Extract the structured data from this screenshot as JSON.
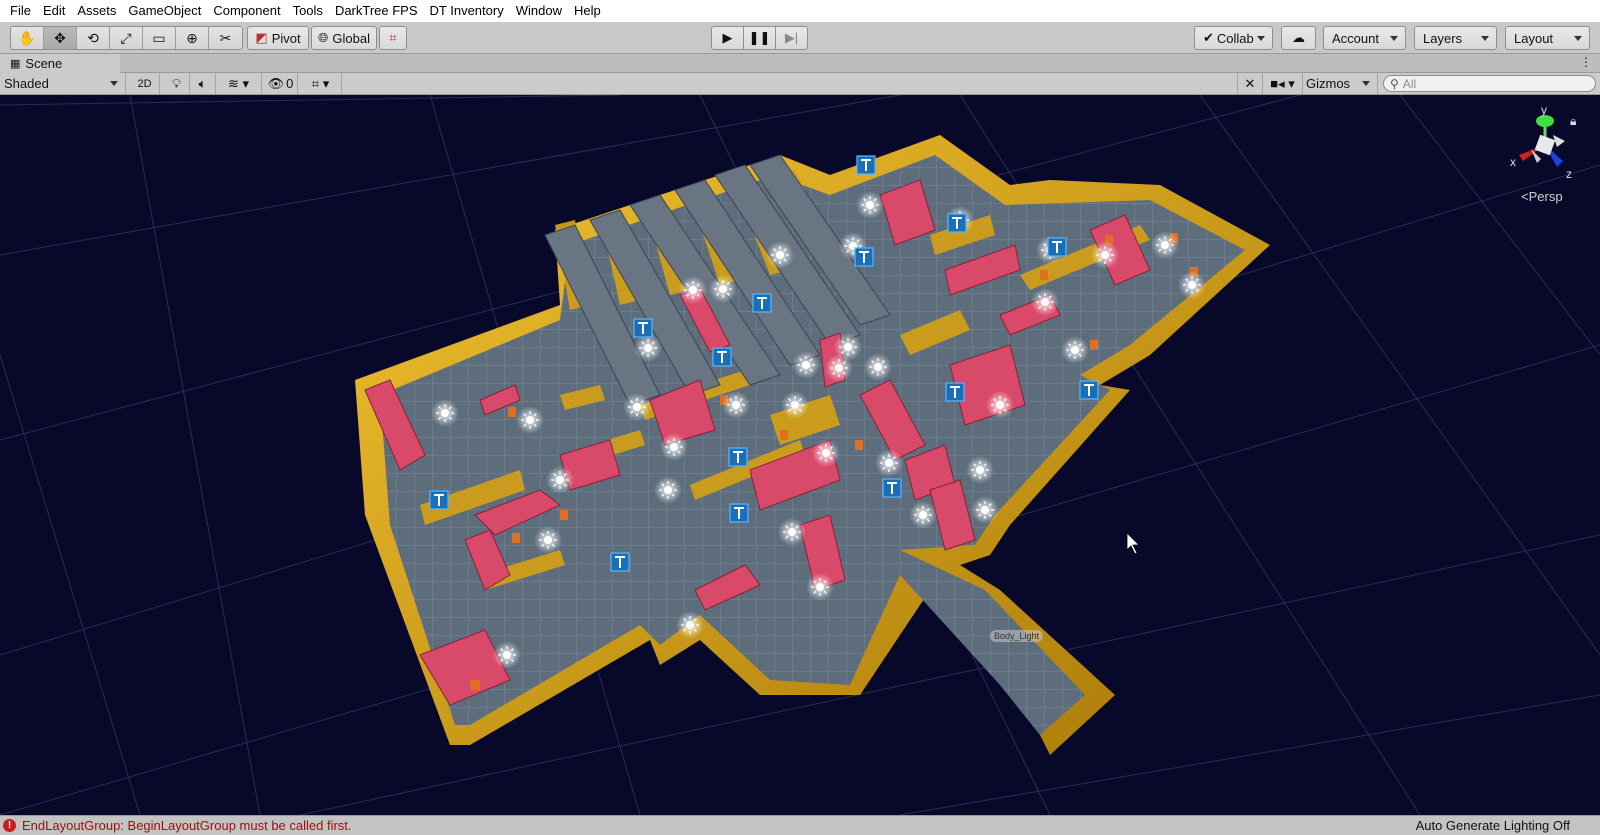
{
  "menu": [
    "File",
    "Edit",
    "Assets",
    "GameObject",
    "Component",
    "Tools",
    "DarkTree FPS",
    "DT Inventory",
    "Window",
    "Help"
  ],
  "toolbar": {
    "tools": [
      {
        "name": "hand-tool",
        "icon": "hand-icon",
        "glyph": "✋"
      },
      {
        "name": "move-tool",
        "icon": "move-icon",
        "glyph": "✥"
      },
      {
        "name": "rotate-tool",
        "icon": "rotate-icon",
        "glyph": "⟲"
      },
      {
        "name": "scale-tool",
        "icon": "scale-icon",
        "glyph": "⤢"
      },
      {
        "name": "rect-tool",
        "icon": "rect-icon",
        "glyph": "▭"
      },
      {
        "name": "transform-tool",
        "icon": "transform-icon",
        "glyph": "⊕"
      },
      {
        "name": "custom-tool",
        "icon": "wrench-icon",
        "glyph": "✂"
      }
    ],
    "pivot": "Pivot",
    "global": "Global",
    "collab": "Collab",
    "account": "Account",
    "layers": "Layers",
    "layout": "Layout"
  },
  "scene_tab": "Scene",
  "scene_bar": {
    "shading_mode": "Shaded",
    "mode_2d": "2D",
    "hidden_count": "0",
    "gizmos": "Gizmos",
    "search_placeholder": "All"
  },
  "scene_gizmo": {
    "axis_y": "y",
    "axis_x": "x",
    "axis_z": "z",
    "projection": "Persp"
  },
  "scene_labels": {
    "body_label": "Body_Light"
  },
  "status": {
    "error": "EndLayoutGroup: BeginLayoutGroup must be called first.",
    "lighting": "Auto Generate Lighting Off"
  },
  "colors": {
    "viewport_bg": "#08082a",
    "wall": "#d4a017",
    "floor": "#5a6a78",
    "prop": "#d94a6a",
    "error": "#cc1d1d"
  }
}
